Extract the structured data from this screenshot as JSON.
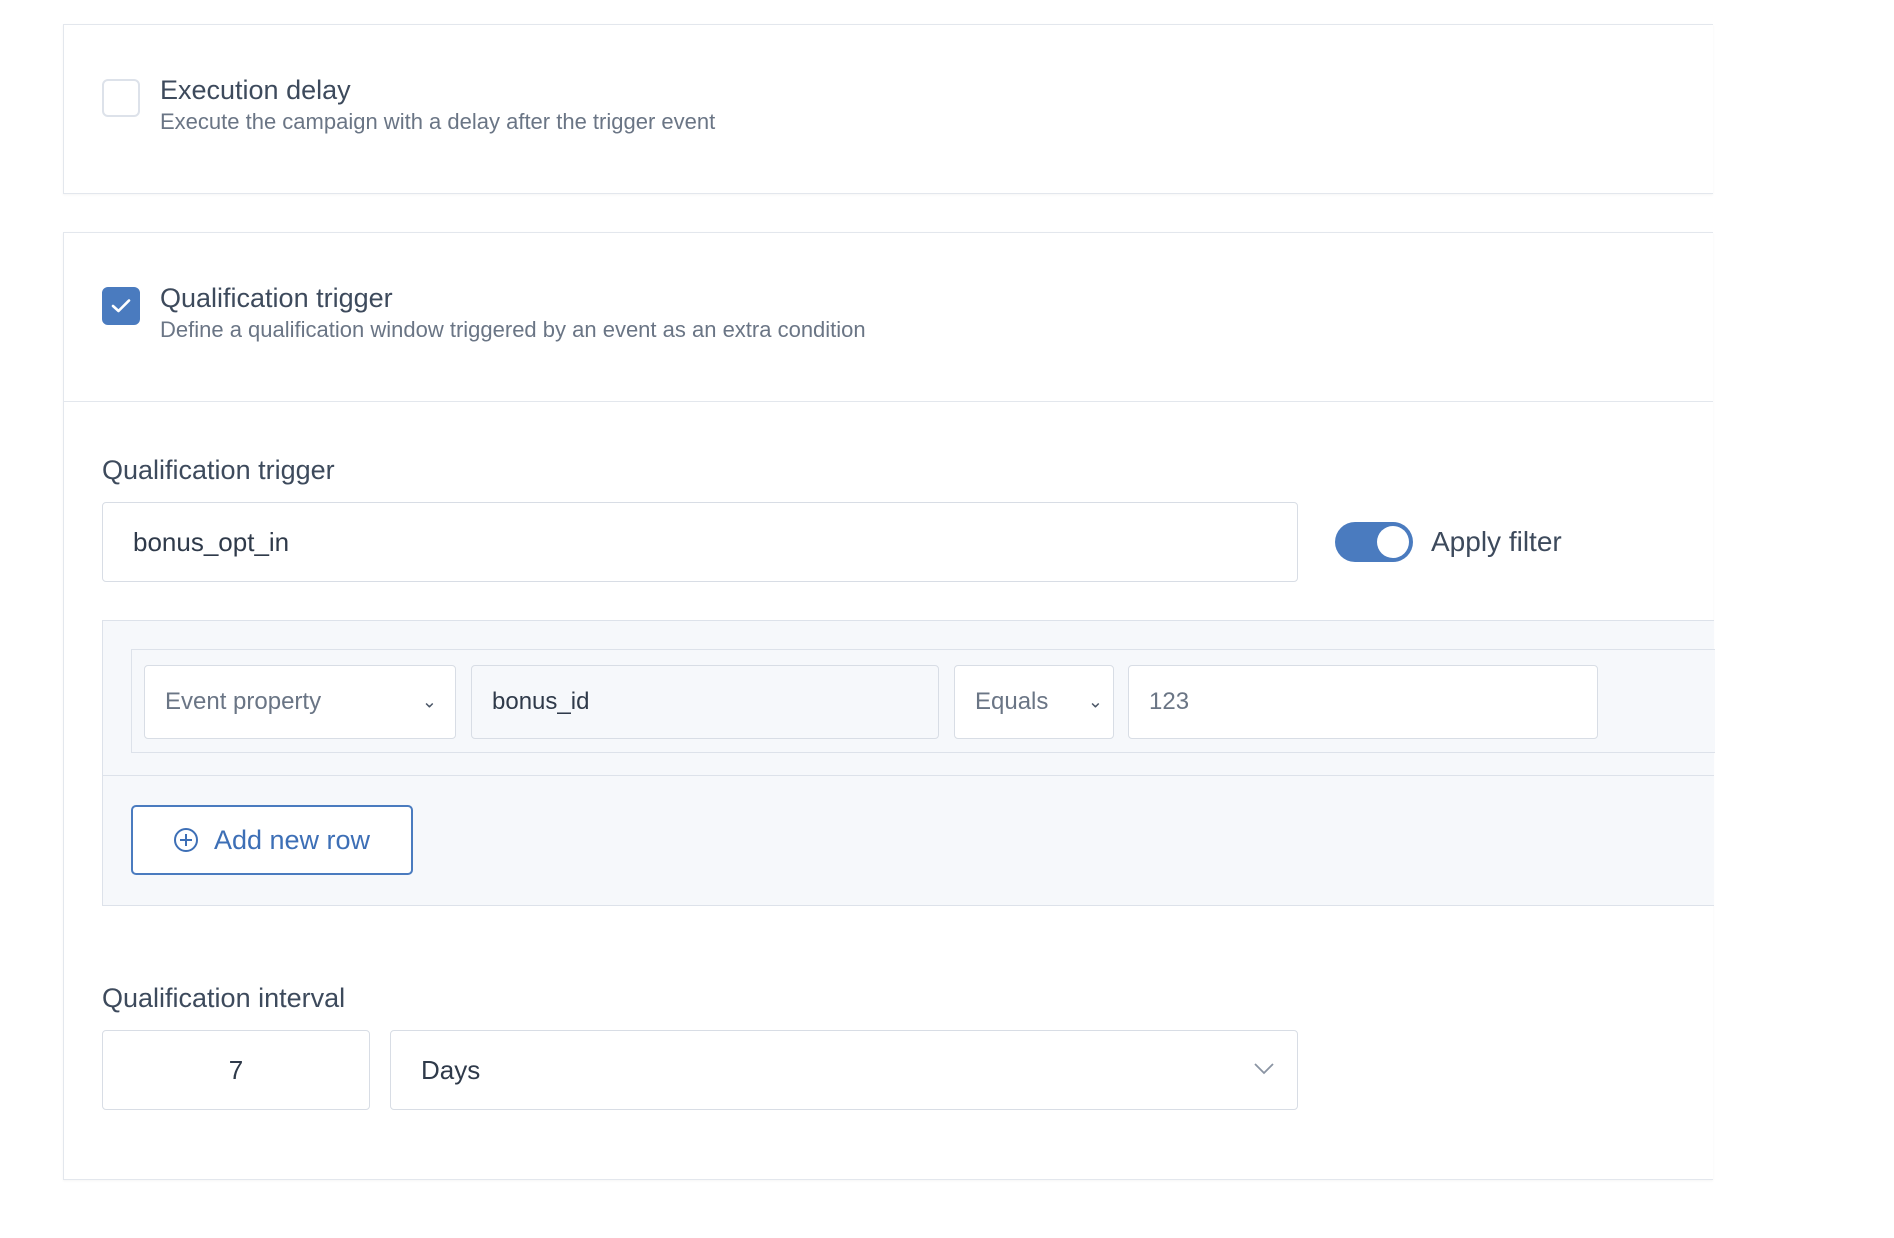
{
  "execution_delay": {
    "title": "Execution delay",
    "description": "Execute the campaign with a delay after the trigger event",
    "checked": false
  },
  "qualification": {
    "title": "Qualification trigger",
    "description": "Define a qualification window triggered by an event as an extra condition",
    "checked": true,
    "trigger_label": "Qualification trigger",
    "trigger_value": "bonus_opt_in",
    "apply_filter_label": "Apply filter",
    "apply_filter_on": true,
    "filter": {
      "property_type": "Event property",
      "property_name": "bonus_id",
      "operator": "Equals",
      "value": "123",
      "add_row_label": "Add new row"
    },
    "interval_label": "Qualification interval",
    "interval_value": "7",
    "interval_unit": "Days"
  },
  "icons": {
    "check": "checkmark-icon",
    "chevron": "chevron-down-icon",
    "add": "plus-circle-icon"
  },
  "colors": {
    "accent": "#4a7bbf",
    "border": "#dde2ea",
    "panel_bg": "#f6f8fb"
  }
}
